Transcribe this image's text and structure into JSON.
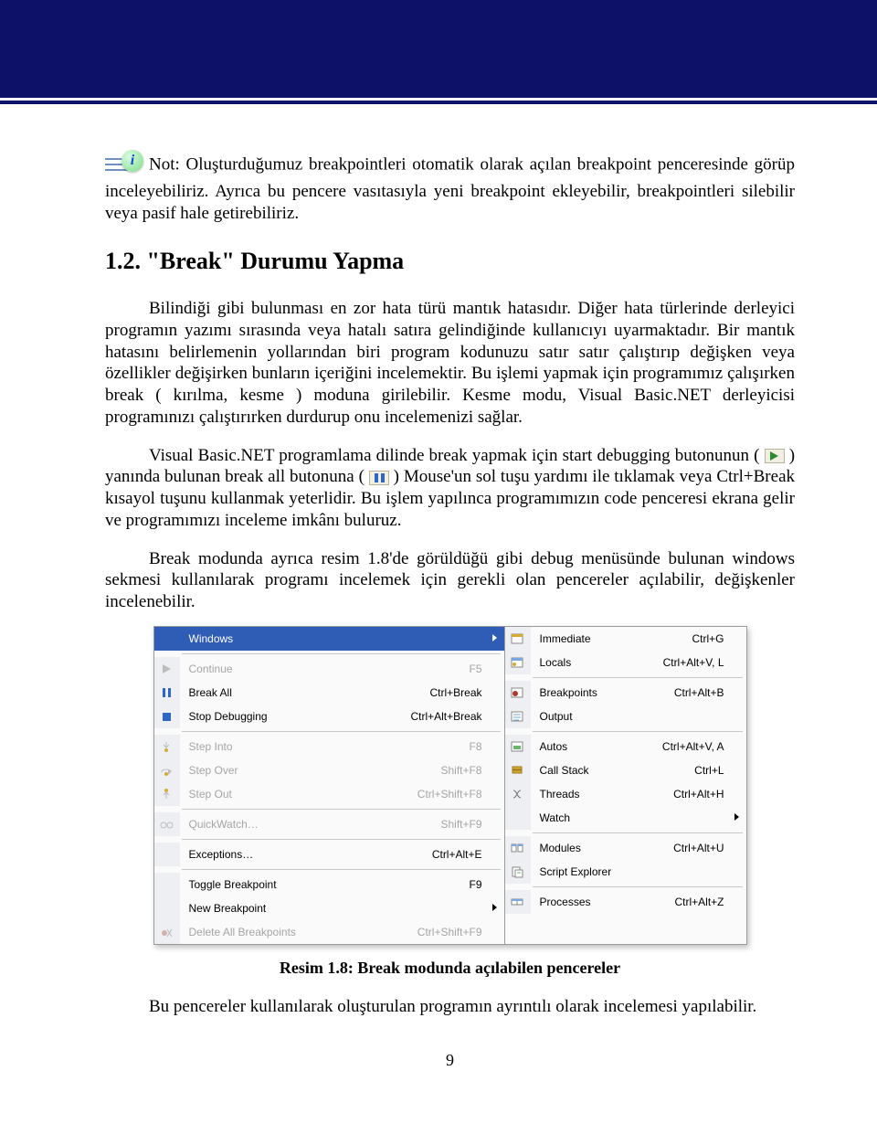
{
  "note": {
    "text": "Not: Oluşturduğumuz breakpointleri otomatik olarak açılan breakpoint penceresinde görüp inceleyebiliriz. Ayrıca bu pencere vasıtasıyla yeni breakpoint ekleyebilir, breakpointleri silebilir veya pasif hale getirebiliriz."
  },
  "heading": "1.2. \"Break\" Durumu Yapma",
  "para1": "Bilindiği gibi bulunması en zor hata türü mantık hatasıdır. Diğer hata türlerinde derleyici programın yazımı sırasında veya hatalı satıra gelindiğinde kullanıcıyı uyarmaktadır. Bir mantık hatasını belirlemenin yollarından biri program kodunuzu satır satır çalıştırıp değişken veya özellikler değişirken bunların içeriğini incelemektir. Bu işlemi yapmak için programımız çalışırken break ( kırılma, kesme ) moduna girilebilir. Kesme modu, Visual Basic.NET derleyicisi programınızı çalıştırırken durdurup onu incelemenizi sağlar.",
  "para2a": "Visual Basic.NET programlama dilinde break yapmak için start debugging butonunun (",
  "para2b": ") yanında bulunan break all butonuna (",
  "para2c": ") Mouse'un sol tuşu yardımı ile tıklamak veya Ctrl+Break kısayol tuşunu kullanmak yeterlidir. Bu işlem yapılınca programımızın code penceresi ekrana gelir ve programımızı inceleme imkânı buluruz.",
  "para3": "Break modunda ayrıca resim 1.8'de görüldüğü gibi debug menüsünde bulunan windows sekmesi kullanılarak programı incelemek için gerekli olan pencereler açılabilir, değişkenler incelenebilir.",
  "menu_left": [
    {
      "label": "Windows",
      "shortcut": "",
      "state": "highlight",
      "sub": true,
      "icon": "none"
    },
    {
      "sep": true
    },
    {
      "label": "Continue",
      "shortcut": "F5",
      "state": "disabled",
      "icon": "play-small"
    },
    {
      "label": "Break All",
      "shortcut": "Ctrl+Break",
      "state": "",
      "icon": "pause-blue"
    },
    {
      "label": "Stop Debugging",
      "shortcut": "Ctrl+Alt+Break",
      "state": "",
      "icon": "stop-blue"
    },
    {
      "sep": true
    },
    {
      "label": "Step Into",
      "shortcut": "F8",
      "state": "disabled",
      "icon": "step-into"
    },
    {
      "label": "Step Over",
      "shortcut": "Shift+F8",
      "state": "disabled",
      "icon": "step-over"
    },
    {
      "label": "Step Out",
      "shortcut": "Ctrl+Shift+F8",
      "state": "disabled",
      "icon": "step-out"
    },
    {
      "sep": true
    },
    {
      "label": "QuickWatch…",
      "shortcut": "Shift+F9",
      "state": "disabled",
      "icon": "glasses"
    },
    {
      "sep": true
    },
    {
      "label": "Exceptions…",
      "shortcut": "Ctrl+Alt+E",
      "state": "",
      "icon": "none"
    },
    {
      "sep": true
    },
    {
      "label": "Toggle Breakpoint",
      "shortcut": "F9",
      "state": "",
      "icon": "none"
    },
    {
      "label": "New Breakpoint",
      "shortcut": "",
      "state": "",
      "sub": true,
      "icon": "none"
    },
    {
      "label": "Delete All Breakpoints",
      "shortcut": "Ctrl+Shift+F9",
      "state": "disabled",
      "icon": "del-bp"
    }
  ],
  "menu_right": [
    {
      "label": "Immediate",
      "shortcut": "Ctrl+G",
      "icon": "win-yellow"
    },
    {
      "label": "Locals",
      "shortcut": "Ctrl+Alt+V, L",
      "icon": "win-locals"
    },
    {
      "sep": true
    },
    {
      "label": "Breakpoints",
      "shortcut": "Ctrl+Alt+B",
      "icon": "bp-red"
    },
    {
      "label": "Output",
      "shortcut": "",
      "icon": "win-lines"
    },
    {
      "sep": true
    },
    {
      "label": "Autos",
      "shortcut": "Ctrl+Alt+V, A",
      "icon": "win-green"
    },
    {
      "label": "Call Stack",
      "shortcut": "Ctrl+L",
      "icon": "callstack"
    },
    {
      "label": "Threads",
      "shortcut": "Ctrl+Alt+H",
      "icon": "threads"
    },
    {
      "label": "Watch",
      "shortcut": "",
      "sub": true,
      "icon": "none"
    },
    {
      "sep": true
    },
    {
      "label": "Modules",
      "shortcut": "Ctrl+Alt+U",
      "icon": "modules"
    },
    {
      "label": "Script Explorer",
      "shortcut": "",
      "icon": "script"
    },
    {
      "sep": true
    },
    {
      "label": "Processes",
      "shortcut": "Ctrl+Alt+Z",
      "icon": "processes"
    }
  ],
  "caption": "Resim 1.8: Break modunda açılabilen pencereler",
  "closing": "Bu pencereler kullanılarak oluşturulan programın ayrıntılı olarak incelemesi yapılabilir.",
  "page_number": "9"
}
